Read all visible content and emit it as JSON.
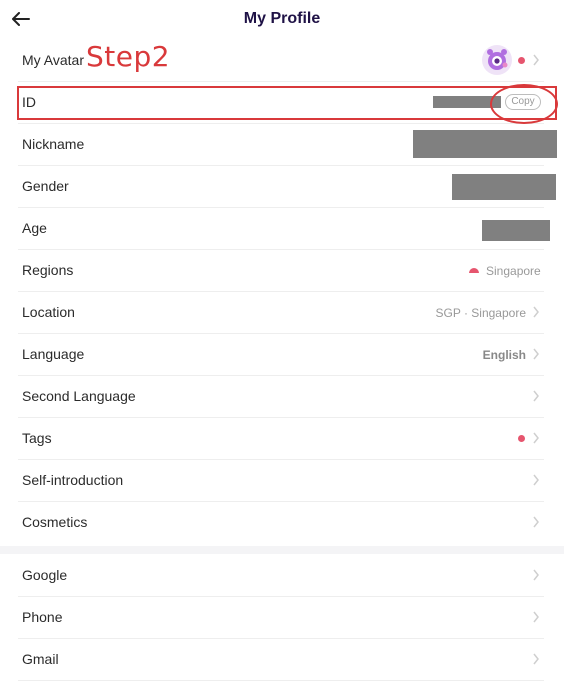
{
  "header": {
    "title": "My Profile"
  },
  "annotation": {
    "step_text": "Step2"
  },
  "rows": [
    {
      "label": "My Avatar"
    },
    {
      "label": "ID",
      "copy_label": "Copy"
    },
    {
      "label": "Nickname"
    },
    {
      "label": "Gender"
    },
    {
      "label": "Age"
    },
    {
      "label": "Regions",
      "value": "Singapore"
    },
    {
      "label": "Location",
      "value": "SGP · Singapore"
    },
    {
      "label": "Language",
      "value": "English"
    },
    {
      "label": "Second Language"
    },
    {
      "label": "Tags"
    },
    {
      "label": "Self-introduction"
    },
    {
      "label": "Cosmetics"
    }
  ],
  "accounts": [
    {
      "label": "Google"
    },
    {
      "label": "Phone"
    },
    {
      "label": "Gmail"
    }
  ],
  "colors": {
    "accent_red": "#d9393b",
    "dot_pink": "#e6556e",
    "title_navy": "#1f1246",
    "redaction_gray": "#808080"
  },
  "icons": {
    "back": "arrow-left",
    "chevron": "chevron-right",
    "flag": "singapore-flag"
  }
}
